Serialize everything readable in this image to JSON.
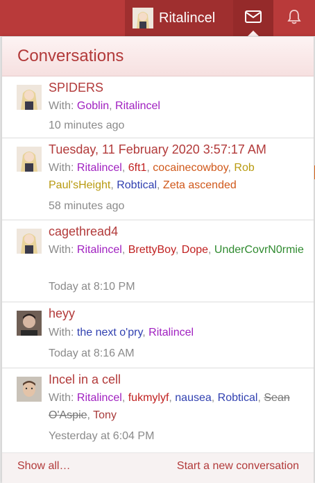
{
  "header": {
    "username": "Ritalincel",
    "avatar_icon": "anime-girl-avatar",
    "messages_icon": "envelope-icon",
    "alerts_icon": "bell-icon"
  },
  "panel": {
    "title": "Conversations",
    "show_all": "Show all…",
    "start_new": "Start a new conversation"
  },
  "conversations": [
    {
      "title": "SPIDERS",
      "with_label": "With:",
      "participants": [
        "Goblin",
        "Ritalincel"
      ],
      "time": "10 minutes ago"
    },
    {
      "title": "Tuesday, 11 February 2020 3:57:17 AM",
      "with_label": "With:",
      "participants": [
        "Ritalincel",
        "6ft1",
        "cocainecowboy",
        "Rob Paul'sHeight",
        "Robtical",
        "Zeta ascended"
      ],
      "time": "58 minutes ago"
    },
    {
      "title": "cagethread4",
      "with_label": "With:",
      "participants": [
        "Ritalincel",
        "BrettyBoy",
        "Dope",
        "UnderCovrN0rmie"
      ],
      "time": "Today at 8:10 PM"
    },
    {
      "title": "heyy",
      "with_label": "With:",
      "participants": [
        "the next o'pry",
        "Ritalincel"
      ],
      "time": "Today at 8:16 AM"
    },
    {
      "title": "Incel in a cell",
      "with_label": "With:",
      "participants": [
        "Ritalincel",
        "fukmylyf",
        "nausea",
        "Robtical",
        "Sean O'Aspie",
        "Tony"
      ],
      "time": "Yesterday at 6:04 PM"
    }
  ]
}
